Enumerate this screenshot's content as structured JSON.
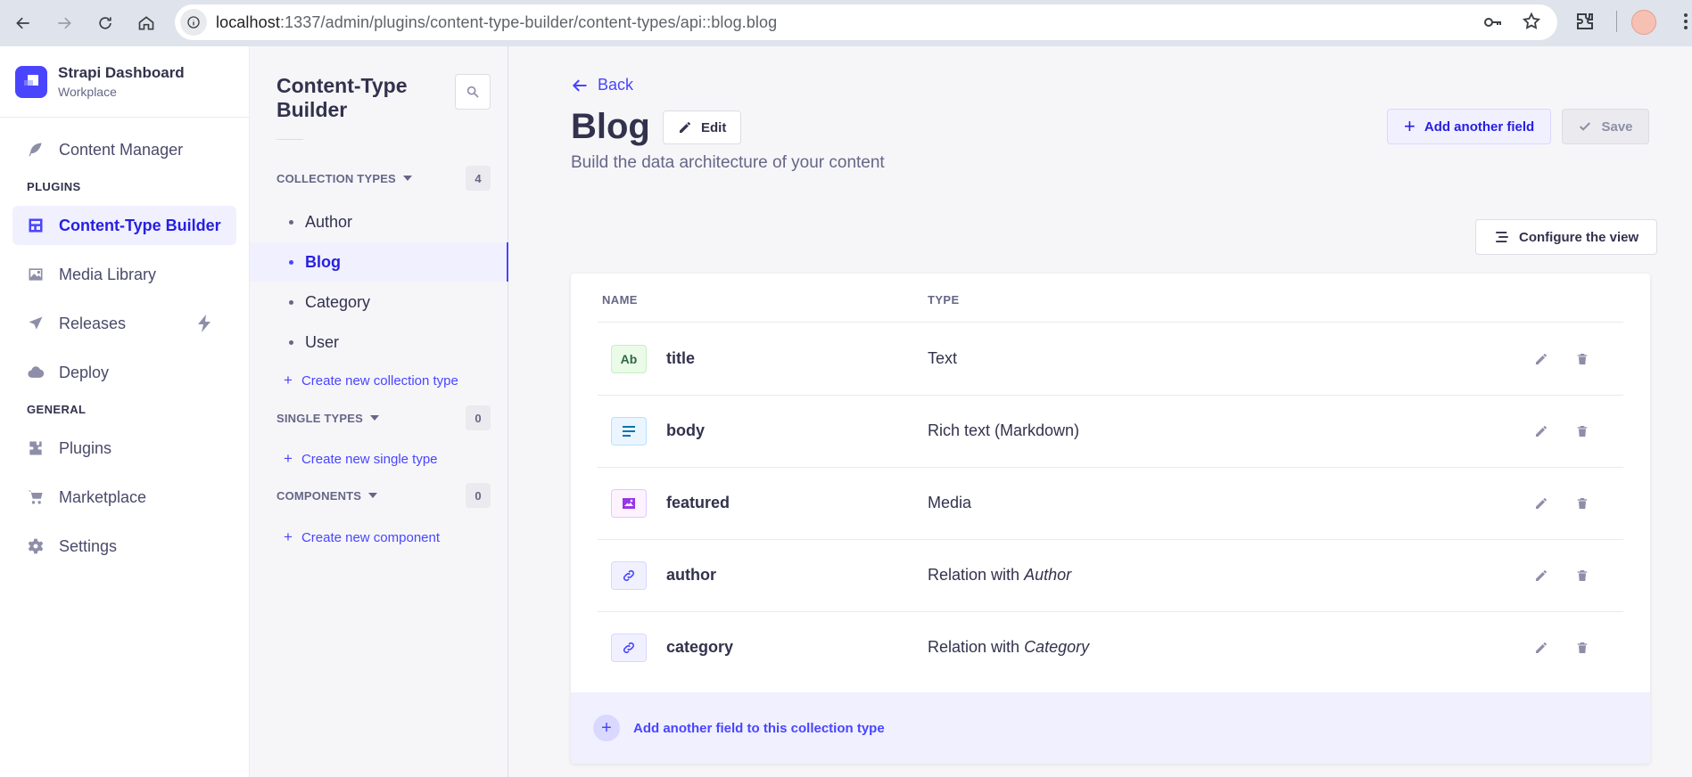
{
  "browser": {
    "url_host": "localhost",
    "url_path": ":1337/admin/plugins/content-type-builder/content-types/api::blog.blog"
  },
  "brand": {
    "title": "Strapi Dashboard",
    "subtitle": "Workplace",
    "color": "#4945ff"
  },
  "sidebar": {
    "items_top": [
      {
        "label": "Content Manager",
        "icon": "feather-icon"
      }
    ],
    "plugins_heading": "PLUGINS",
    "plugins": [
      {
        "label": "Content-Type Builder",
        "icon": "layout-icon",
        "active": true
      },
      {
        "label": "Media Library",
        "icon": "image-icon"
      },
      {
        "label": "Releases",
        "icon": "paper-plane-icon",
        "badge": "lightning-icon"
      },
      {
        "label": "Deploy",
        "icon": "cloud-icon"
      }
    ],
    "general_heading": "GENERAL",
    "general": [
      {
        "label": "Plugins",
        "icon": "puzzle-icon"
      },
      {
        "label": "Marketplace",
        "icon": "cart-icon"
      },
      {
        "label": "Settings",
        "icon": "gear-icon"
      }
    ]
  },
  "subnav": {
    "title": "Content-Type Builder",
    "collection_heading": "COLLECTION TYPES",
    "collection_count": "4",
    "collection_items": [
      "Author",
      "Blog",
      "Category",
      "User"
    ],
    "active_item": "Blog",
    "create_collection": "Create new collection type",
    "single_heading": "SINGLE TYPES",
    "single_count": "0",
    "create_single": "Create new single type",
    "components_heading": "COMPONENTS",
    "components_count": "0",
    "create_component": "Create new component"
  },
  "main": {
    "back_label": "Back",
    "title": "Blog",
    "edit_label": "Edit",
    "subtitle": "Build the data architecture of your content",
    "add_field_label": "Add another field",
    "save_label": "Save",
    "configure_label": "Configure the view",
    "table": {
      "col_name": "NAME",
      "col_type": "TYPE",
      "rows": [
        {
          "name": "title",
          "type": "Text",
          "type_target": "",
          "icon": "text-icon",
          "icon_label": "Ab"
        },
        {
          "name": "body",
          "type": "Rich text (Markdown)",
          "type_target": "",
          "icon": "rich-text-icon",
          "icon_label": ""
        },
        {
          "name": "featured",
          "type": "Media",
          "type_target": "",
          "icon": "media-icon",
          "icon_label": ""
        },
        {
          "name": "author",
          "type": "Relation with ",
          "type_target": "Author",
          "icon": "relation-icon",
          "icon_label": ""
        },
        {
          "name": "category",
          "type": "Relation with ",
          "type_target": "Category",
          "icon": "relation-icon",
          "icon_label": ""
        }
      ]
    },
    "footer_label": "Add another field to this collection type"
  }
}
